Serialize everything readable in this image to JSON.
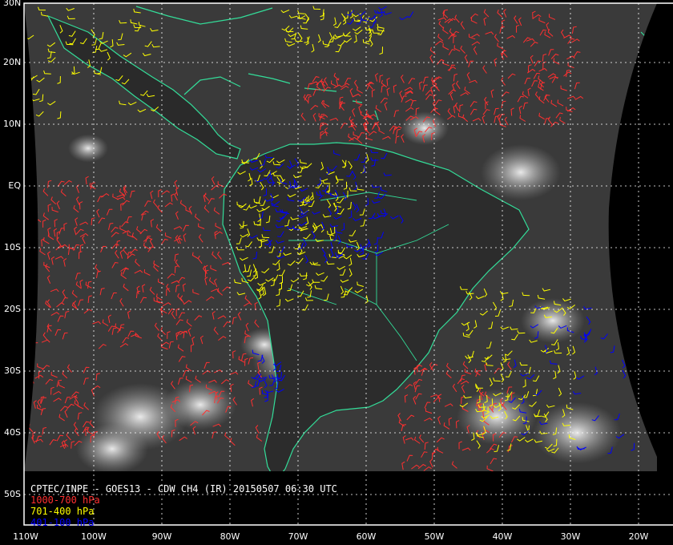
{
  "caption": {
    "title": "CPTEC/INPE - GOES13 - CDW CH4 (IR) 20150507 06:30 UTC",
    "legend": [
      {
        "label": "1000-700 hPa",
        "color": "#ff3030"
      },
      {
        "label": "701-400 hPa",
        "color": "#ffff00"
      },
      {
        "label": "401-100 hPa",
        "color": "#0000ff"
      }
    ]
  },
  "lat_labels": [
    "30N",
    "20N",
    "10N",
    "EQ",
    "10S",
    "20S",
    "30S",
    "40S",
    "50S"
  ],
  "lon_labels": [
    "110W",
    "100W",
    "90W",
    "80W",
    "70W",
    "60W",
    "50W",
    "40W",
    "30W",
    "20W"
  ],
  "colors": {
    "coastline": "#33dd99",
    "grid": "#ffffff",
    "background": "#000000",
    "cloud": "#dcdcdc",
    "ocean": "#3c3c3c"
  }
}
